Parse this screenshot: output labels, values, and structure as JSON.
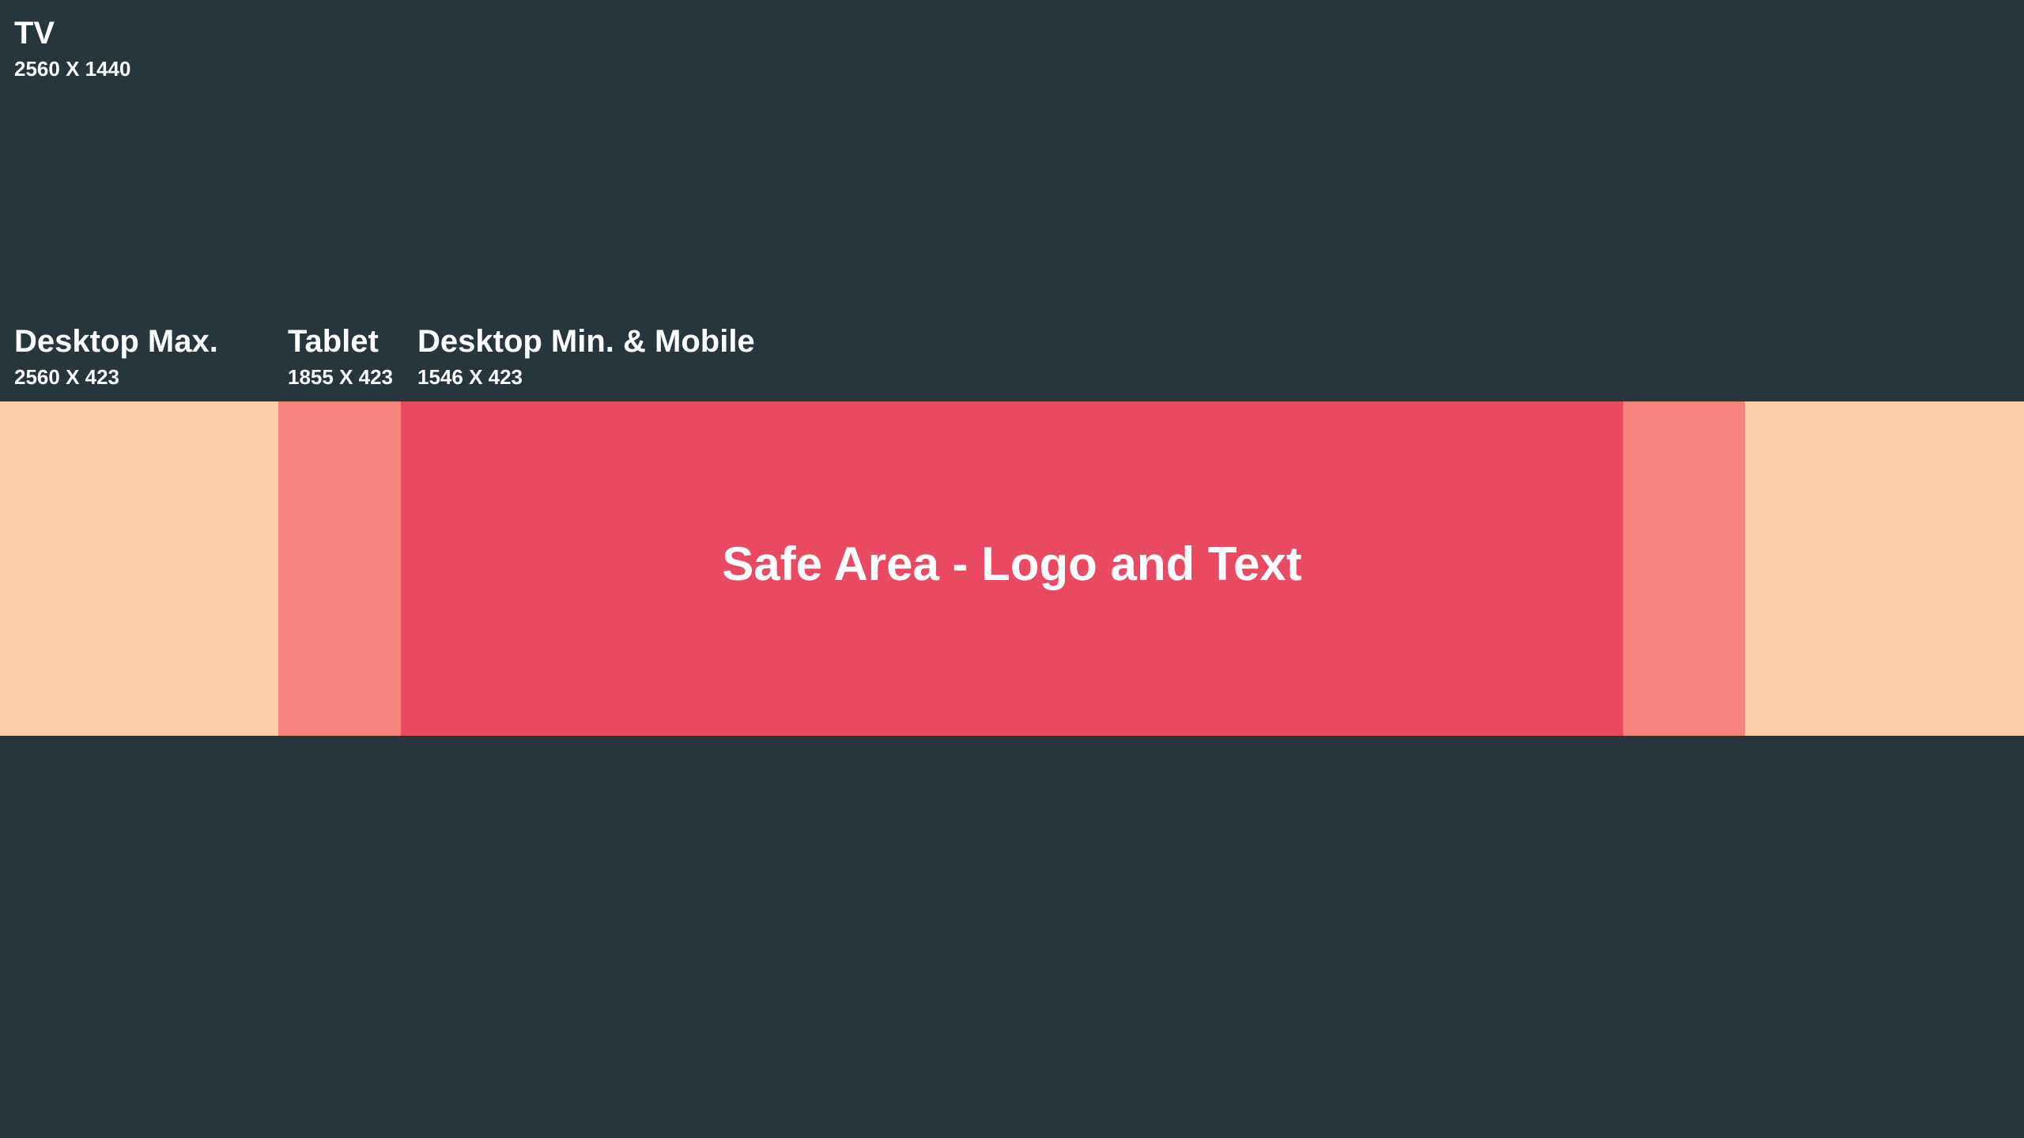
{
  "colors": {
    "background": "#27353C",
    "desktop_max": "#FCCEA8",
    "tablet": "#F4847C",
    "safe_area": "#E94A61",
    "text": "#FFFFFF"
  },
  "tv": {
    "title": "TV",
    "size": "2560 X 1440"
  },
  "desktop_max": {
    "title": "Desktop Max.",
    "size": "2560 X 423"
  },
  "tablet": {
    "title": "Tablet",
    "size": "1855 X 423"
  },
  "desktop_min_mobile": {
    "title": "Desktop Min. & Mobile",
    "size": "1546 X 423"
  },
  "safe_area": {
    "label": "Safe Area - Logo and Text"
  }
}
